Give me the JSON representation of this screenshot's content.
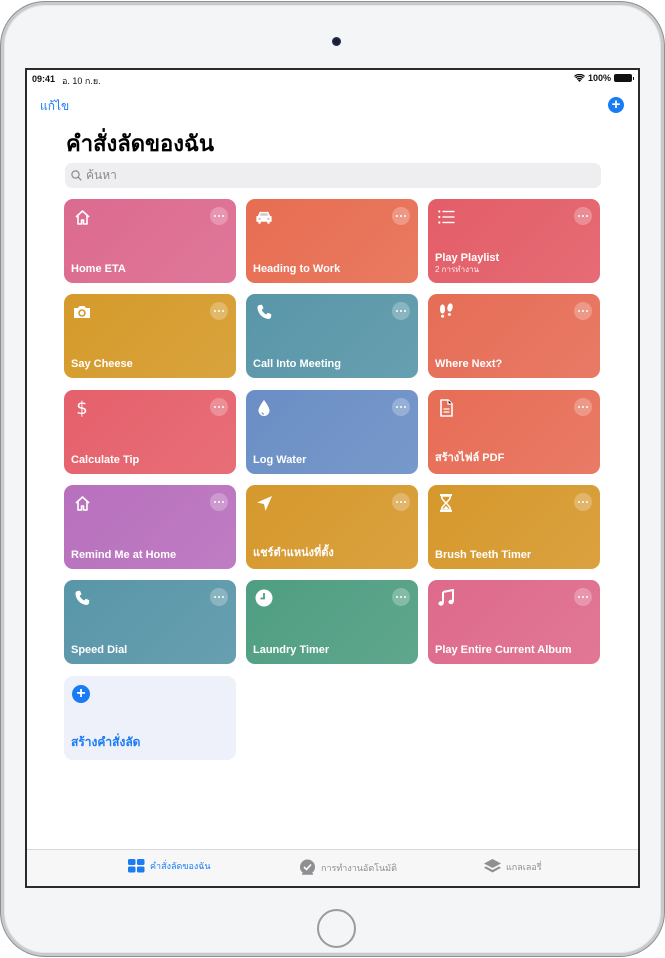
{
  "status_bar": {
    "time": "09:41",
    "date": "อ. 10 ก.ย.",
    "battery": "100%"
  },
  "nav": {
    "edit_label": "แก้ไข",
    "add_icon": "plus-circle-icon"
  },
  "page_title": "คำสั่งลัดของฉัน",
  "search": {
    "placeholder": "ค้นหา"
  },
  "shortcuts": [
    {
      "label": "Home ETA",
      "icon": "house-icon",
      "color": "#dc6a8f"
    },
    {
      "label": "Heading to Work",
      "icon": "car-icon",
      "color": "#e76d51"
    },
    {
      "label": "Play Playlist",
      "subtitle": "2 การทำงาน",
      "icon": "list-icon",
      "color": "#e35d67"
    },
    {
      "label": "Say Cheese",
      "icon": "camera-icon",
      "color": "#d59a2a"
    },
    {
      "label": "Call Into Meeting",
      "icon": "phone-icon",
      "color": "#5896a8"
    },
    {
      "label": "Where Next?",
      "icon": "footprints-icon",
      "color": "#e66d56"
    },
    {
      "label": "Calculate Tip",
      "icon": "dollar-icon",
      "color": "#e5606b"
    },
    {
      "label": "Log Water",
      "icon": "water-drop-icon",
      "color": "#6a8ec5"
    },
    {
      "label": "สร้างไฟล์ PDF",
      "icon": "document-icon",
      "color": "#e76d56"
    },
    {
      "label": "Remind Me at Home",
      "icon": "house-icon",
      "color": "#b870bd"
    },
    {
      "label": "แชร์ตำแหน่งที่ตั้ง",
      "icon": "location-arrow-icon",
      "color": "#d6982c"
    },
    {
      "label": "Brush Teeth Timer",
      "icon": "hourglass-icon",
      "color": "#d6982c"
    },
    {
      "label": "Speed Dial",
      "icon": "phone-icon",
      "color": "#5896a8"
    },
    {
      "label": "Laundry Timer",
      "icon": "clock-icon",
      "color": "#4f9e82"
    },
    {
      "label": "Play Entire Current Album",
      "icon": "music-note-icon",
      "color": "#de6a8b"
    }
  ],
  "create_shortcut": {
    "label": "สร้างคำสั่งลัด"
  },
  "tabs": [
    {
      "label": "คำสั่งลัดของฉัน",
      "icon": "grid-icon",
      "active": true
    },
    {
      "label": "การทำงานอัตโนมัติ",
      "icon": "automation-check-icon",
      "active": false
    },
    {
      "label": "แกลเลอรี่",
      "icon": "layers-icon",
      "active": false
    }
  ]
}
